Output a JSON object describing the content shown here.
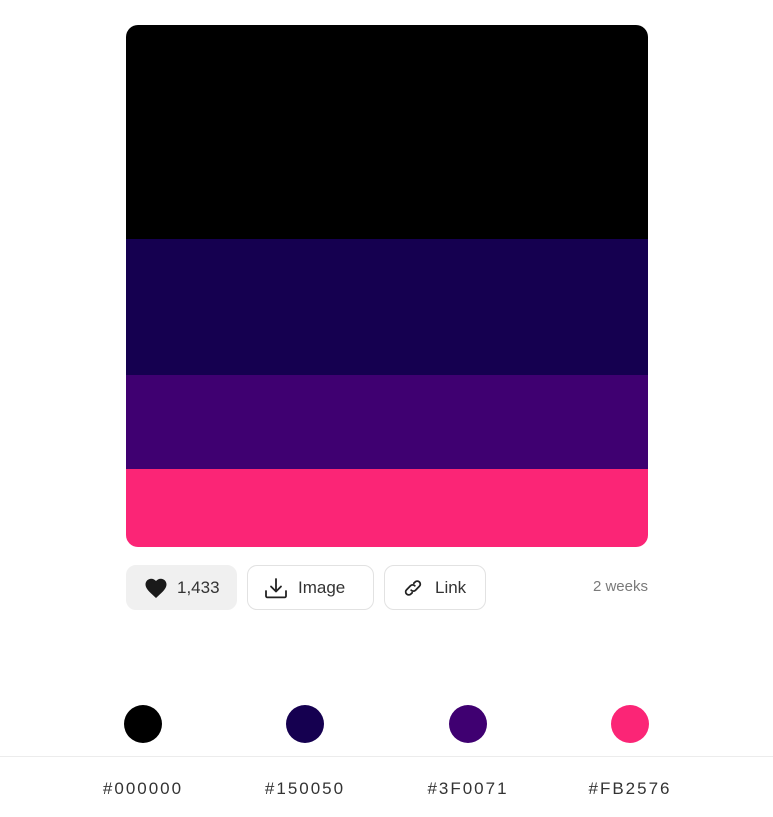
{
  "palette": {
    "colors": [
      {
        "hex": "#000000",
        "label": "#000000"
      },
      {
        "hex": "#150050",
        "label": "#150050"
      },
      {
        "hex": "#3F0071",
        "label": "#3F0071"
      },
      {
        "hex": "#FB2576",
        "label": "#FB2576"
      }
    ]
  },
  "actions": {
    "likes": "1,433",
    "image_label": "Image",
    "link_label": "Link",
    "date": "2 weeks"
  },
  "icons": {
    "like": "heart-icon",
    "image": "download-icon",
    "link": "link-icon"
  },
  "ui_colors": {
    "like_button_bg": "#f0f0f0",
    "button_border": "#e2e2e2",
    "date_text": "#7a7a7a"
  }
}
